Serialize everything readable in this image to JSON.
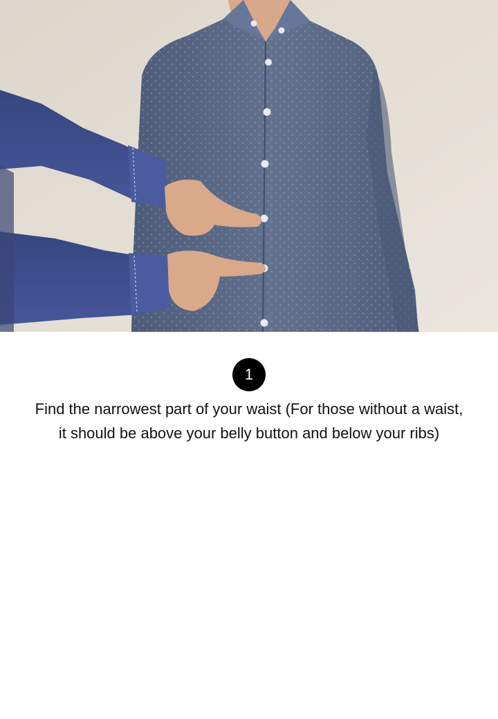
{
  "illustration": {
    "description_icon": "waist-measurement-photo",
    "colors": {
      "wall": "#e4ddd2",
      "shirt": "#5a6a86",
      "sleeve_helper": "#3f4f8e",
      "skin": "#d9a98a",
      "button": "#e8e8ee"
    }
  },
  "step": {
    "number": "1",
    "instruction_line1": "Find the narrowest part of your waist (For those without a waist,",
    "instruction_line2": "it should be above your belly button and below your ribs)"
  }
}
